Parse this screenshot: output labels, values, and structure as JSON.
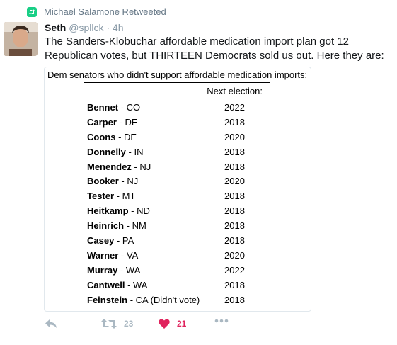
{
  "retweet_context": {
    "text": "Michael Salamone Retweeted",
    "icon": "retweet-icon",
    "color": "#19cf86"
  },
  "tweet": {
    "author_name": "Seth",
    "author_handle": "@spllck",
    "separator": "·",
    "time": "4h",
    "text": "The Sanders-Klobuchar affordable medication import plan got 12 Republican votes, but THIRTEEN Democrats sold us out. Here they are:"
  },
  "media": {
    "title": "Dem senators who didn't support affordable medication imports:",
    "table_header": "Next election:",
    "senators": [
      {
        "name": "Bennet",
        "state": " - CO",
        "election": "2022"
      },
      {
        "name": "Carper",
        "state": " - DE",
        "election": "2018"
      },
      {
        "name": "Coons",
        "state": " - DE",
        "election": "2020"
      },
      {
        "name": "Donnelly",
        "state": " - IN",
        "election": "2018"
      },
      {
        "name": "Menendez",
        "state": " - NJ",
        "election": "2018"
      },
      {
        "name": "Booker",
        "state": " - NJ",
        "election": "2020"
      },
      {
        "name": "Tester",
        "state": " - MT",
        "election": "2018"
      },
      {
        "name": "Heitkamp",
        "state": " - ND",
        "election": "2018"
      },
      {
        "name": "Heinrich",
        "state": " - NM",
        "election": "2018"
      },
      {
        "name": "Casey",
        "state": " - PA",
        "election": "2018"
      },
      {
        "name": "Warner",
        "state": " - VA",
        "election": "2020"
      },
      {
        "name": "Murray",
        "state": " - WA",
        "election": "2022"
      },
      {
        "name": "Cantwell",
        "state": " - WA",
        "election": "2018"
      },
      {
        "name": "Feinstein",
        "state": " - CA (Didn't vote)",
        "election": "2018"
      }
    ]
  },
  "actions": {
    "reply_icon": "reply-icon",
    "retweet_icon": "retweet-icon",
    "retweet_count": "23",
    "like_icon": "heart-icon",
    "like_count": "21",
    "like_color": "#e0245e",
    "more_icon": "more-icon"
  }
}
